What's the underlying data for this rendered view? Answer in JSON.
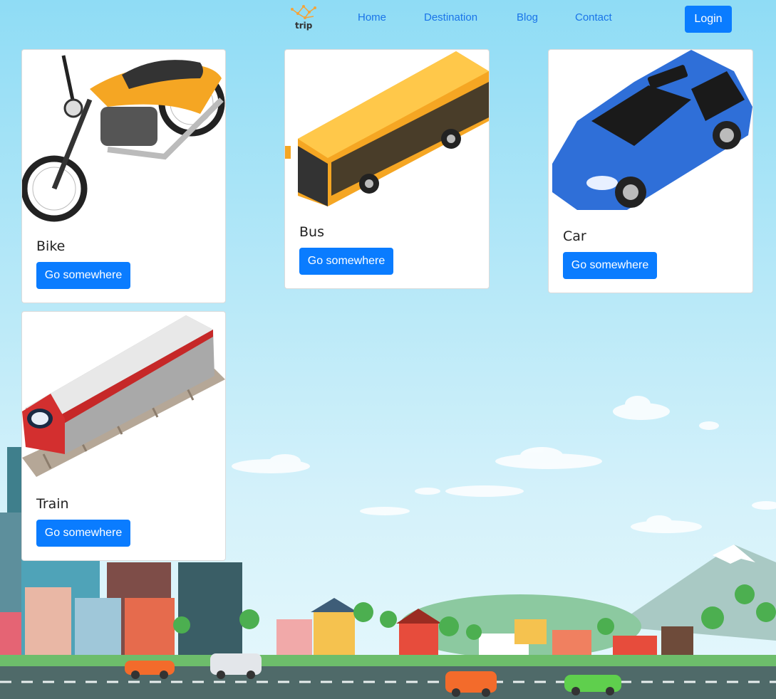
{
  "nav": {
    "logo_text": "trip",
    "links": [
      "Home",
      "Destination",
      "Blog",
      "Contact"
    ],
    "login_label": "Login"
  },
  "cards": [
    {
      "title": "Bike",
      "button": "Go somewhere",
      "icon": "motorcycle"
    },
    {
      "title": "Bus",
      "button": "Go somewhere",
      "icon": "bus"
    },
    {
      "title": "Car",
      "button": "Go somewhere",
      "icon": "car"
    },
    {
      "title": "Train",
      "button": "Go somewhere",
      "icon": "train"
    }
  ],
  "colors": {
    "sky_top": "#8fdcf5",
    "sky_bottom": "#d9f3fb",
    "accent": "#0a7cff",
    "link": "#1a74e8",
    "road": "#4f6a69"
  }
}
